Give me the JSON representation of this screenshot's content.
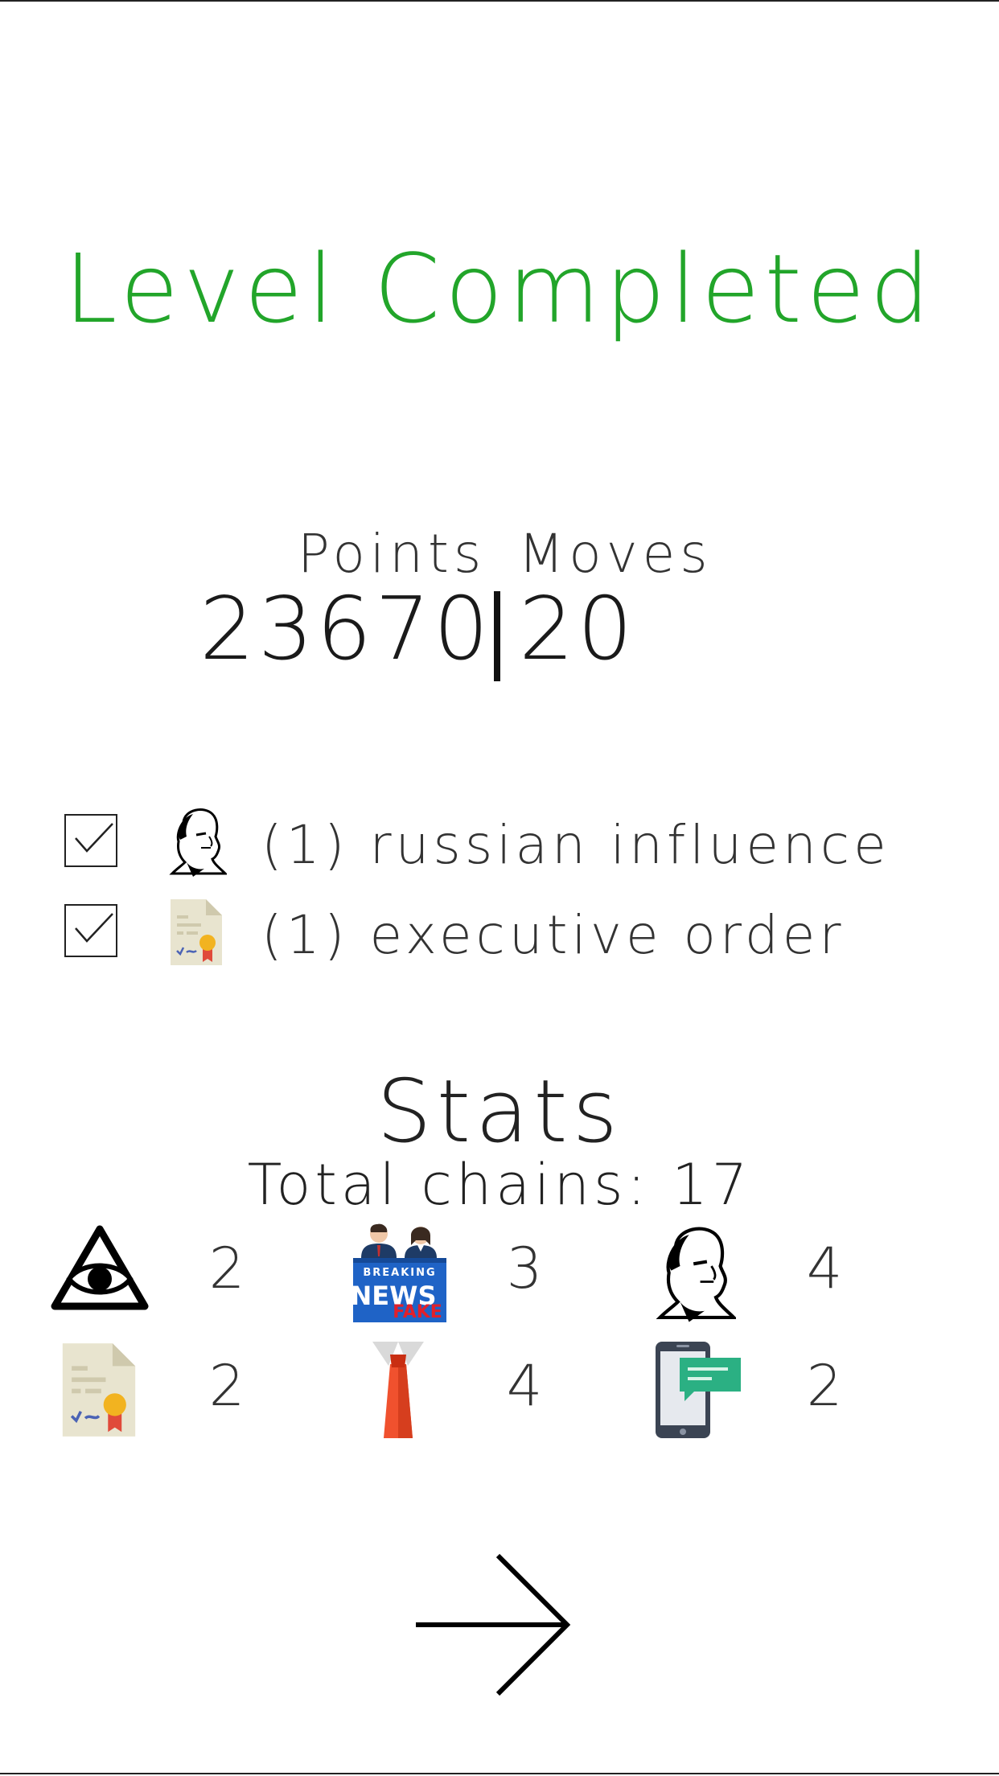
{
  "title": "Level Completed",
  "score": {
    "points_label": "Points",
    "moves_label": "Moves",
    "points_value": "23670",
    "moves_value": "20"
  },
  "goals": [
    {
      "icon": "putin-portrait-icon",
      "text": "(1) russian influence",
      "checked": true
    },
    {
      "icon": "executive-order-icon",
      "text": "(1) executive order",
      "checked": true
    }
  ],
  "stats": {
    "title": "Stats",
    "total_chains_text": "Total chains: 17",
    "items": [
      {
        "icon": "illuminati-eye-icon",
        "count": "2"
      },
      {
        "icon": "fake-news-icon",
        "count": "3"
      },
      {
        "icon": "putin-portrait-icon",
        "count": "4"
      },
      {
        "icon": "executive-order-icon",
        "count": "2"
      },
      {
        "icon": "red-tie-icon",
        "count": "4"
      },
      {
        "icon": "phone-message-icon",
        "count": "2"
      }
    ]
  },
  "colors": {
    "title": "#22a52a",
    "text": "#333333"
  },
  "next_icon": "arrow-right-icon"
}
